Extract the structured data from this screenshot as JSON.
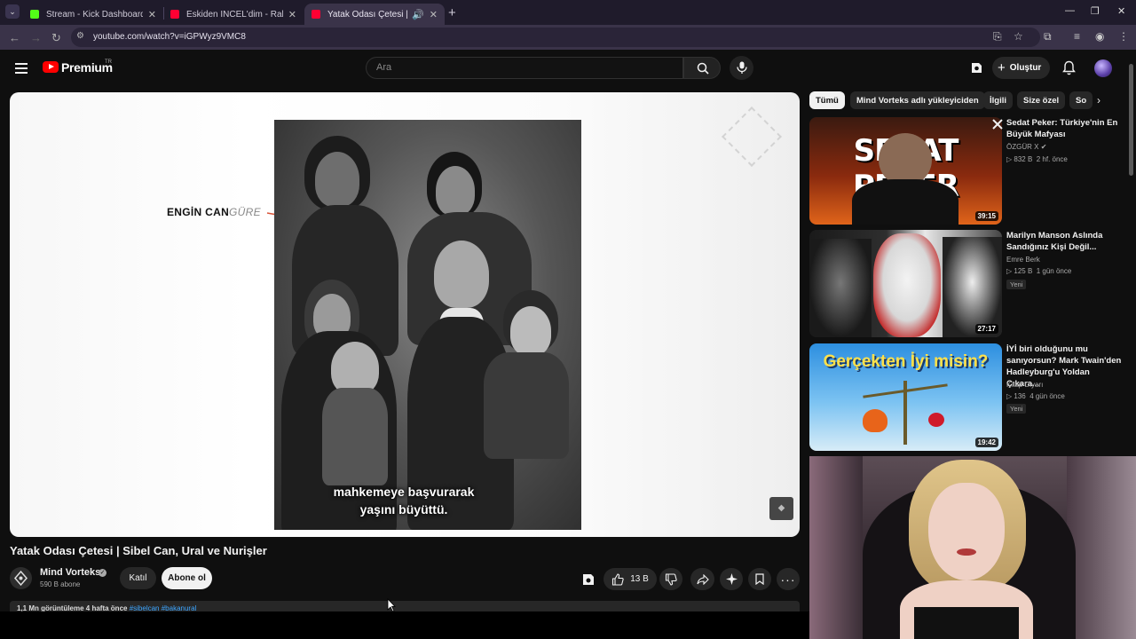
{
  "browser": {
    "tab_menu_icon": "chevron-down-icon",
    "tabs": [
      {
        "title": "Stream - Kick Dashboard",
        "favicon_color": "#53fc18"
      },
      {
        "title": "Eskiden İNCEL'dim - Rahatsız Edi",
        "favicon_color": "#ff0033"
      },
      {
        "title": "Yatak Odası Çetesi | Sibel Can,",
        "favicon_color": "#ff0033"
      }
    ],
    "url": "youtube.com/watch?v=iGPWyz9VMC8"
  },
  "masthead": {
    "logo_text": "Premium",
    "region": "TR",
    "search_placeholder": "Ara",
    "create_label": "Oluştur"
  },
  "player": {
    "overlay_name_bold": "ENGİN CAN",
    "overlay_name_light": "GÜRE",
    "subtitle_line1": "mahkemeye başvurarak",
    "subtitle_line2": "yaşını büyüttü."
  },
  "video": {
    "title": "Yatak Odası Çetesi | Sibel Can, Ural ve Nurişler",
    "channel": "Mind Vorteks",
    "subscribers": "590 B abone",
    "join_label": "Katıl",
    "subscribe_label": "Abone ol",
    "likes": "13 B",
    "description_stats": "1,1 Mn görüntüleme  4 hafta önce",
    "hashtags": "#sibelcan #bakanural"
  },
  "sidebar": {
    "chips": [
      "Tümü",
      "Mind Vorteks adlı yükleyiciden",
      "İlgili",
      "Size özel",
      "So"
    ],
    "recommendations": [
      {
        "title": "Sedat Peker: Türkiye'nin En Büyük Mafyası",
        "channel": "ÖZGÜR X",
        "views": "832 B",
        "age": "2 hf. önce",
        "duration": "39:15",
        "thumb_text": "SEDAT PEKER",
        "badge": ""
      },
      {
        "title": "Marilyn Manson Aslında Sandığınız Kişi Değil...",
        "channel": "Emre Berk",
        "views": "125 B",
        "age": "1 gün önce",
        "duration": "27:17",
        "thumb_text": "",
        "badge": "Yeni"
      },
      {
        "title": "İYİ biri olduğunu mu sanıyorsun? Mark Twain'den Hadleyburg'u Yoldan Çıkara...",
        "channel": "Kitap Diyarı",
        "views": "136",
        "age": "4 gün önce",
        "duration": "19:42",
        "thumb_text": "Gerçekten İyi misin?",
        "badge": "Yeni"
      }
    ]
  }
}
